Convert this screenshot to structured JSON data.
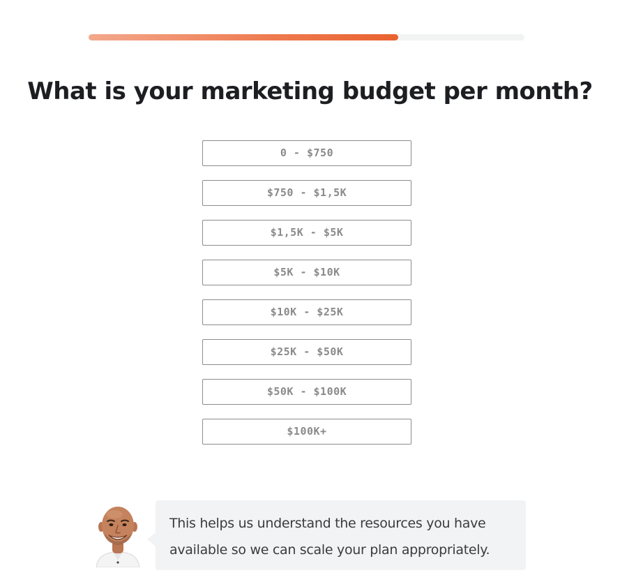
{
  "progress": {
    "value": 0.71,
    "fill_color": "#e9622f",
    "track_color": "#f2f3f3"
  },
  "question": {
    "text": "What is your marketing budget per month?"
  },
  "options": [
    {
      "label": "0 - $750"
    },
    {
      "label": "$750 - $1,5K"
    },
    {
      "label": "$1,5K - $5K"
    },
    {
      "label": "$5K - $10K"
    },
    {
      "label": "$10K - $25K"
    },
    {
      "label": "$25K - $50K"
    },
    {
      "label": "$50K - $100K"
    },
    {
      "label": "$100K+"
    }
  ],
  "helper": {
    "avatar_icon": "person-photo",
    "text": "This helps us understand the resources you have available so we can scale your plan appropriately."
  }
}
